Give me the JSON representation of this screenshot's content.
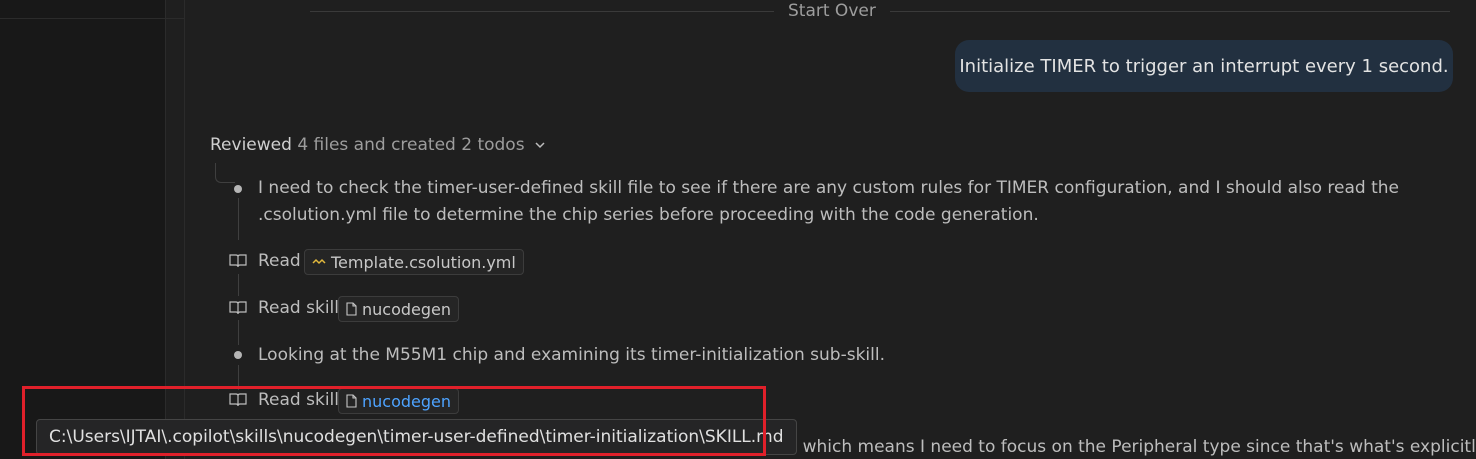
{
  "header": {
    "start_over_label": "Start Over"
  },
  "user_message": {
    "text": "Initialize TIMER to trigger an interrupt every 1 second."
  },
  "summary": {
    "reviewed_label": "Reviewed",
    "reviewed_detail": "4 files and created 2 todos",
    "expand_icon": "chevron-down-icon"
  },
  "steps": {
    "thought1_line1": "I need to check the timer-user-defined skill file to see if there are any custom rules for TIMER configuration, and I should also read the",
    "thought1_line2": ".csolution.yml file to determine the chip series before proceeding with the code generation.",
    "read1_label": "Read",
    "read1_file": "Template.csolution.yml",
    "read2_label": "Read skill",
    "read2_file": "nucodegen",
    "thought2": "Looking at the M55M1 chip and examining its timer-initialization sub-skill.",
    "read3_label": "Read skill",
    "read3_file": "nucodegen",
    "truncated_text": "d, which means I need to focus on the Peripheral type since that's what's explicitly"
  },
  "tooltip": {
    "path": "C:\\Users\\IJTAI\\.copilot\\skills\\nucodegen\\timer-user-defined\\timer-initialization\\SKILL.md"
  },
  "colors": {
    "background": "#1f1f1f",
    "bubble": "#223040",
    "link": "#4da3ff",
    "highlight": "#e0202a"
  }
}
